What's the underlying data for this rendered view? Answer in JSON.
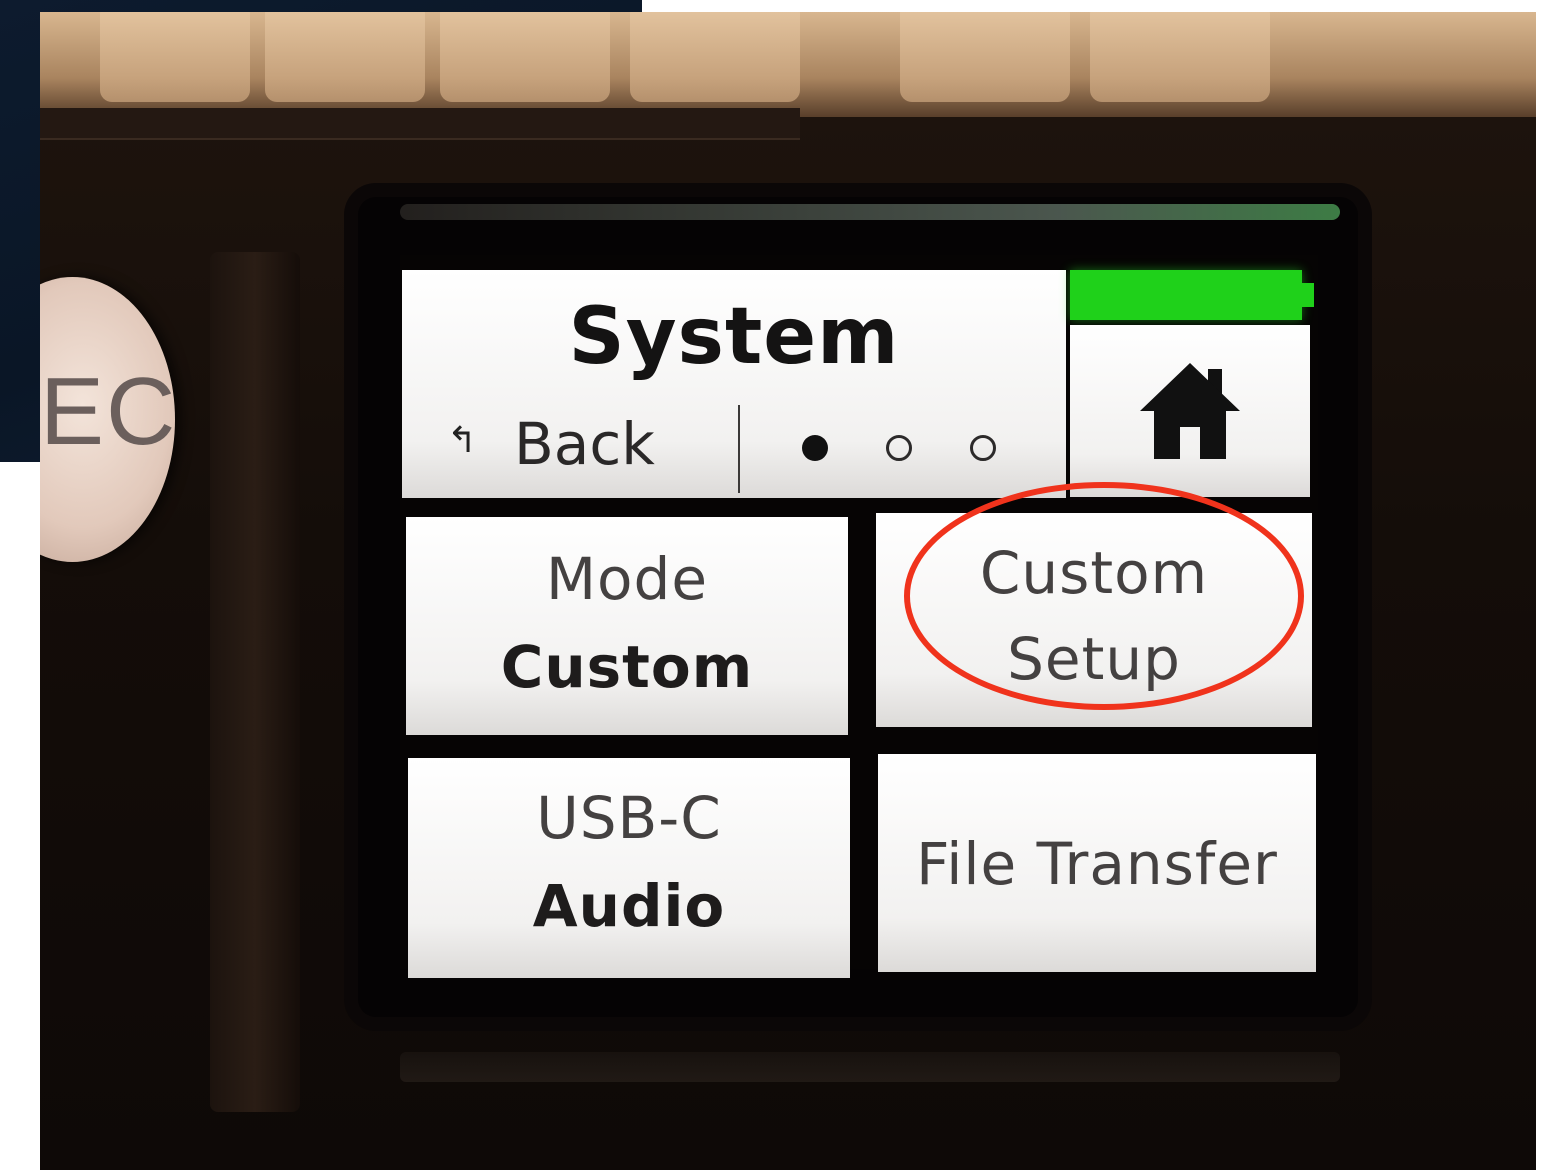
{
  "device": {
    "side_button_label": "EC"
  },
  "screen": {
    "header": {
      "title": "System",
      "back_glyph": "↰",
      "back_label": "Back",
      "page_indicator": {
        "total": 3,
        "current": 1
      }
    },
    "battery": {
      "level": 1.0,
      "color": "#1fd11a"
    },
    "home_button": {
      "icon": "home-icon"
    },
    "tiles": [
      {
        "id": "mode",
        "line1": "Mode",
        "line2": "Custom"
      },
      {
        "id": "custom_setup",
        "line1": "Custom",
        "line2": "Setup"
      },
      {
        "id": "usb_c",
        "line1": "USB-C",
        "line2": "Audio"
      },
      {
        "id": "file_transfer",
        "line1": "File Transfer"
      }
    ]
  },
  "annotation": {
    "color": "#f0331c"
  }
}
